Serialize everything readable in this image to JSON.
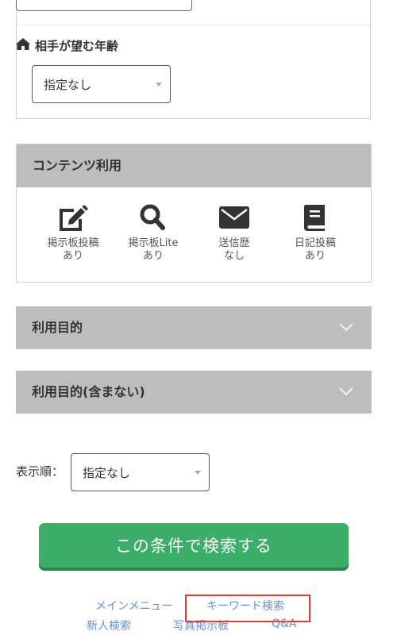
{
  "filters": {
    "partner_age": {
      "label": "相手が望む年齢",
      "selected": "指定なし"
    }
  },
  "contents": {
    "title": "コンテンツ利用",
    "features": [
      {
        "icon": "edit-icon",
        "label": "掲示板投稿",
        "status": "あり"
      },
      {
        "icon": "search-icon",
        "label": "掲示板Lite",
        "status": "あり"
      },
      {
        "icon": "mail-icon",
        "label": "送信歴",
        "status": "なし"
      },
      {
        "icon": "book-icon",
        "label": "日記投稿",
        "status": "あり"
      }
    ]
  },
  "accordions": [
    {
      "label": "利用目的"
    },
    {
      "label": "利用目的(含まない)"
    }
  ],
  "sort": {
    "label": "表示順：",
    "selected": "指定なし"
  },
  "search_button": "この条件で検索する",
  "footer": {
    "links": [
      "メインメニュー",
      "キーワード検索",
      "新人検索",
      "写真掲示板",
      "Q&A"
    ]
  },
  "colors": {
    "accent_green": "#3cae69",
    "header_gray": "#bdbdbd",
    "link_blue": "#6a8fce",
    "highlight_red": "#e53935"
  }
}
